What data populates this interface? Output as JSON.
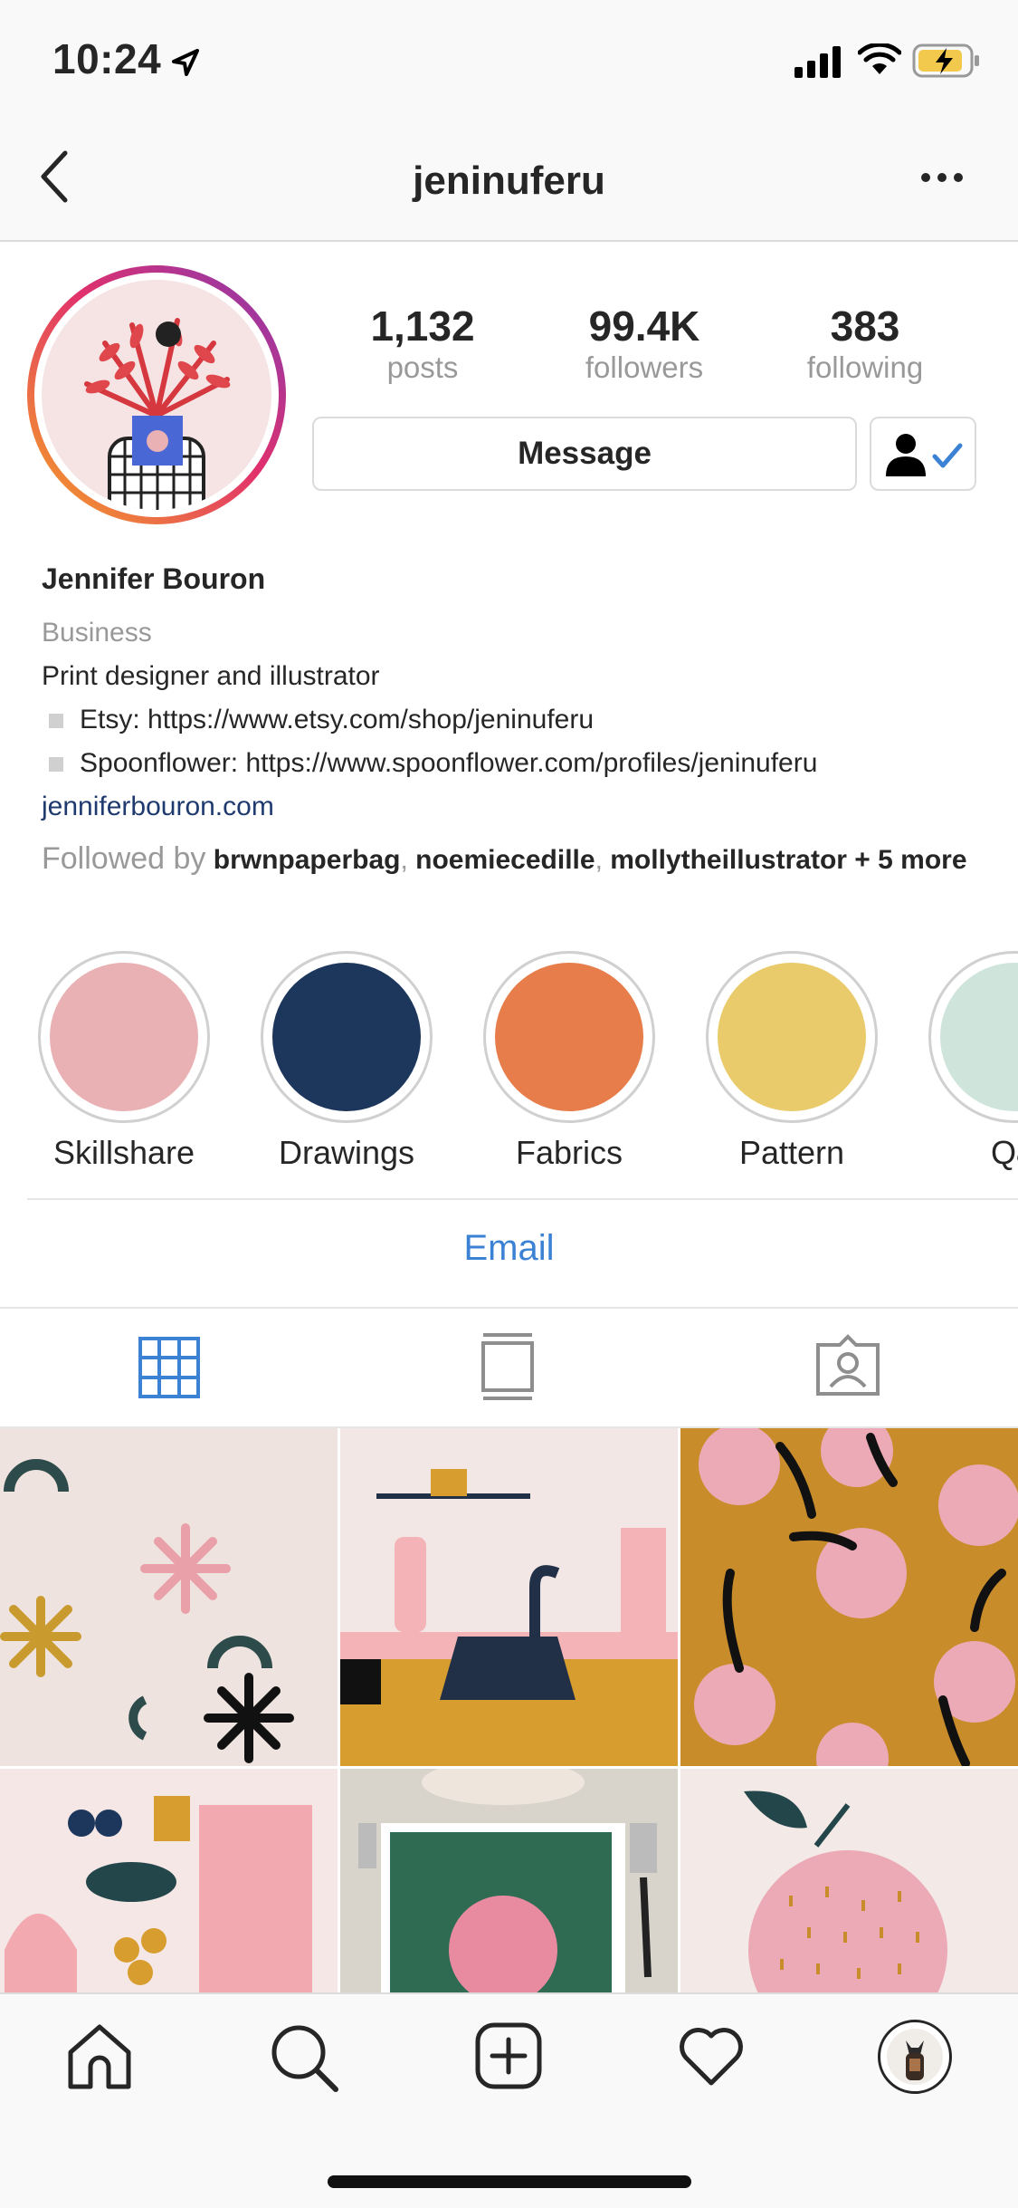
{
  "status": {
    "time": "10:24"
  },
  "header": {
    "username": "jeninuferu"
  },
  "stats": [
    {
      "value": "1,132",
      "label": "posts"
    },
    {
      "value": "99.4K",
      "label": "followers"
    },
    {
      "value": "383",
      "label": "following"
    }
  ],
  "actions": {
    "message_label": "Message"
  },
  "bio": {
    "name": "Jennifer Bouron",
    "category": "Business",
    "description": "Print designer and illustrator",
    "lines": [
      "Etsy: https://www.etsy.com/shop/jeninuferu",
      "Spoonflower: https://www.spoonflower.com/profiles/jeninuferu"
    ],
    "website": "jenniferbouron.com",
    "followed_by_prefix": "Followed by",
    "followed_by_users": [
      "brwnpaperbag",
      "noemiecedille",
      "mollytheillustrator"
    ],
    "followed_by_more": "+ 5 more"
  },
  "highlights": [
    {
      "label": "Skillshare",
      "color": "#e9b1b3"
    },
    {
      "label": "Drawings",
      "color": "#1d365c"
    },
    {
      "label": "Fabrics",
      "color": "#e77d4a"
    },
    {
      "label": "Pattern",
      "color": "#e9cb6c"
    },
    {
      "label": "Q&",
      "color": "#cfe5dc"
    }
  ],
  "contact": {
    "email_label": "Email"
  },
  "tabs": {
    "icons": [
      "grid-icon",
      "feed-icon",
      "tagged-icon"
    ],
    "active_color": "#3b82d4"
  },
  "bottom_nav": {
    "icons": [
      "home-icon",
      "search-icon",
      "add-post-icon",
      "heart-icon",
      "profile-avatar"
    ]
  }
}
